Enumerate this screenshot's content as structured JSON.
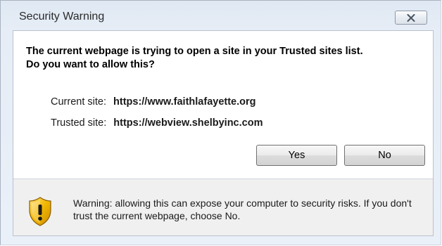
{
  "window": {
    "title": "Security Warning"
  },
  "dialog": {
    "question": "The current webpage is trying to open a site in your Trusted sites list.\nDo you want to allow this?",
    "current_site_label": "Current site:",
    "current_site_value": "https://www.faithlafayette.org",
    "trusted_site_label": "Trusted site:",
    "trusted_site_value": "https://webview.shelbyinc.com",
    "yes_label": "Yes",
    "no_label": "No",
    "warning_text": "Warning: allowing this can expose your computer to security risks. If you don't trust the current webpage, choose No."
  },
  "icons": {
    "close": "close-icon",
    "warning": "shield-warning-icon"
  },
  "colors": {
    "shield_gold": "#f2b600",
    "shield_dark": "#b07a00",
    "titlebar": "#dfe8f3",
    "footer": "#f0f0f0"
  }
}
